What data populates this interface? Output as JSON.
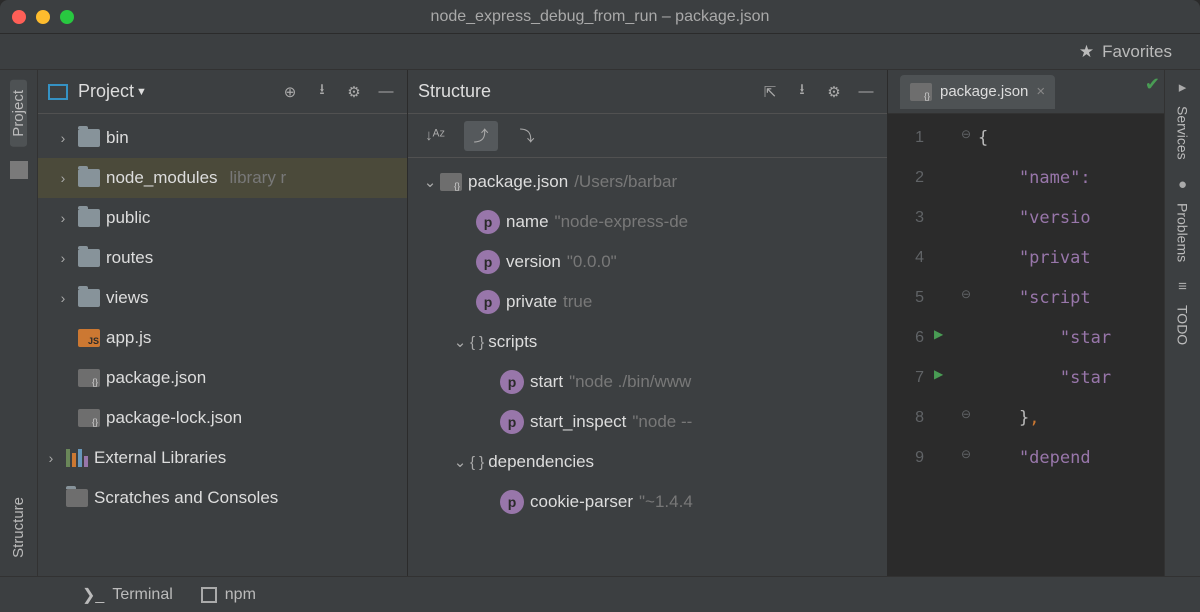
{
  "window": {
    "title": "node_express_debug_from_run – package.json"
  },
  "favorites": {
    "label": "Favorites"
  },
  "leftTabs": {
    "project": "Project",
    "structure": "Structure"
  },
  "projectPanel": {
    "title": "Project",
    "items": [
      {
        "name": "bin",
        "type": "folder",
        "exp": true
      },
      {
        "name": "node_modules",
        "hint": "library r",
        "type": "folder",
        "exp": true,
        "sel": true
      },
      {
        "name": "public",
        "type": "folder",
        "exp": true
      },
      {
        "name": "routes",
        "type": "folder",
        "exp": true
      },
      {
        "name": "views",
        "type": "folder",
        "exp": true
      },
      {
        "name": "app.js",
        "type": "js"
      },
      {
        "name": "package.json",
        "type": "json"
      },
      {
        "name": "package-lock.json",
        "type": "json"
      }
    ],
    "external": "External Libraries",
    "scratches": "Scratches and Consoles"
  },
  "structurePanel": {
    "title": "Structure",
    "root": {
      "name": "package.json",
      "path": "/Users/barbar"
    },
    "props": [
      {
        "name": "name",
        "val": "\"node-express-de"
      },
      {
        "name": "version",
        "val": "\"0.0.0\""
      },
      {
        "name": "private",
        "val": "true"
      }
    ],
    "scripts": {
      "label": "scripts",
      "items": [
        {
          "name": "start",
          "val": "\"node ./bin/www"
        },
        {
          "name": "start_inspect",
          "val": "\"node --"
        }
      ]
    },
    "deps": {
      "label": "dependencies",
      "items": [
        {
          "name": "cookie-parser",
          "val": "\"~1.4.4"
        }
      ]
    }
  },
  "editor": {
    "tab": "package.json",
    "lines": [
      {
        "n": "1",
        "fold": "⊖",
        "t": "{",
        "cls": "pun"
      },
      {
        "n": "2",
        "t": "    \"name\":",
        "cls": "key"
      },
      {
        "n": "3",
        "t": "    \"versio",
        "cls": "key"
      },
      {
        "n": "4",
        "t": "    \"privat",
        "cls": "key"
      },
      {
        "n": "5",
        "fold": "⊖",
        "t": "    \"script",
        "cls": "key"
      },
      {
        "n": "6",
        "run": true,
        "t": "        \"star",
        "cls": "key"
      },
      {
        "n": "7",
        "run": true,
        "t": "        \"star",
        "cls": "key"
      },
      {
        "n": "8",
        "fold": "⊖",
        "t": "    },",
        "cls": "pun"
      },
      {
        "n": "9",
        "fold": "⊖",
        "t": "    \"depend",
        "cls": "key"
      }
    ]
  },
  "rightTabs": {
    "services": "Services",
    "problems": "Problems",
    "todo": "TODO"
  },
  "bottom": {
    "terminal": "Terminal",
    "npm": "npm"
  }
}
